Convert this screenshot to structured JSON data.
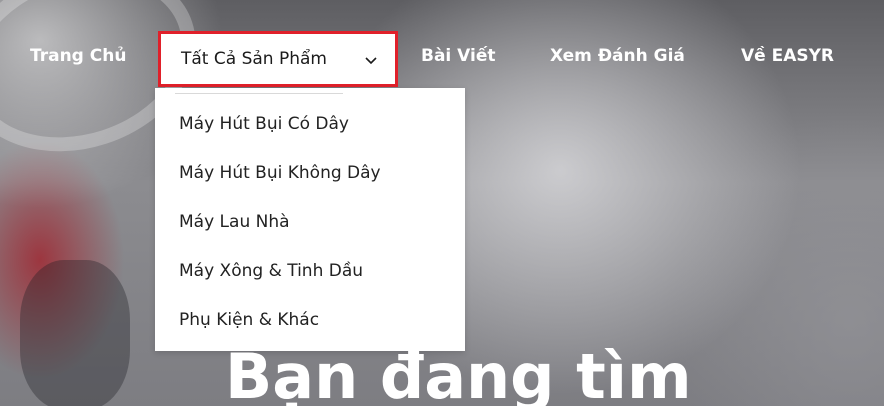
{
  "nav": {
    "items": [
      {
        "label": "Trang Chủ"
      },
      {
        "label": "Tất Cả Sản Phẩm",
        "active": true
      },
      {
        "label": "Bài Viết"
      },
      {
        "label": "Xem Đánh Giá"
      },
      {
        "label": "Về EASYR"
      }
    ],
    "active_border_color": "#e0202a"
  },
  "dropdown": {
    "items": [
      {
        "label": "Máy Hút Bụi Có Dây"
      },
      {
        "label": "Máy Hút Bụi Không Dây"
      },
      {
        "label": "Máy Lau Nhà"
      },
      {
        "label": "Máy Xông & Tinh Dầu"
      },
      {
        "label": "Phụ Kiện & Khác"
      }
    ]
  },
  "hero": {
    "title": "Bạn đang tìm"
  },
  "icons": {
    "dropdown_indicator": "chevron-down-icon"
  }
}
